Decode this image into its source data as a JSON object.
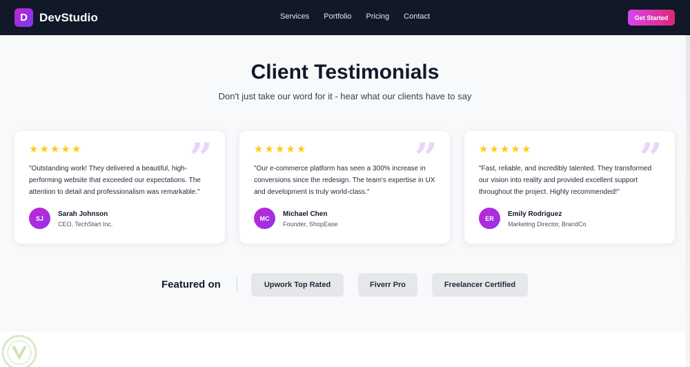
{
  "brand": {
    "initial": "D",
    "name": "DevStudio"
  },
  "nav": {
    "links": [
      "Services",
      "Portfolio",
      "Pricing",
      "Contact"
    ],
    "cta": "Get Started"
  },
  "hero": {
    "title": "Client Testimonials",
    "subtitle": "Don't just take our word for it - hear what our clients have to say"
  },
  "testimonials": [
    {
      "rating": 5,
      "quote": "\"Outstanding work! They delivered a beautiful, high-performing website that exceeded our expectations. The attention to detail and professionalism was remarkable.\"",
      "initials": "SJ",
      "name": "Sarah Johnson",
      "role": "CEO, TechStart Inc."
    },
    {
      "rating": 5,
      "quote": "\"Our e-commerce platform has seen a 300% increase in conversions since the redesign. The team's expertise in UX and development is truly world-class.\"",
      "initials": "MC",
      "name": "Michael Chen",
      "role": "Founder, ShopEase"
    },
    {
      "rating": 5,
      "quote": "\"Fast, reliable, and incredibly talented. They transformed our vision into reality and provided excellent support throughout the project. Highly recommended!\"",
      "initials": "ER",
      "name": "Emily Rodriguez",
      "role": "Marketing Director, BrandCo"
    }
  ],
  "featured": {
    "label": "Featured on",
    "platforms": [
      "Upwork Top Rated",
      "Fiverr Pro",
      "Freelancer Certified"
    ]
  },
  "icons": {
    "rating": "star-icon",
    "quote": "quote-icon"
  },
  "colors": {
    "nav_bg": "#111827",
    "accent": "#c026d3",
    "star": "#facc15",
    "section_bg": "#f8f9fb"
  }
}
